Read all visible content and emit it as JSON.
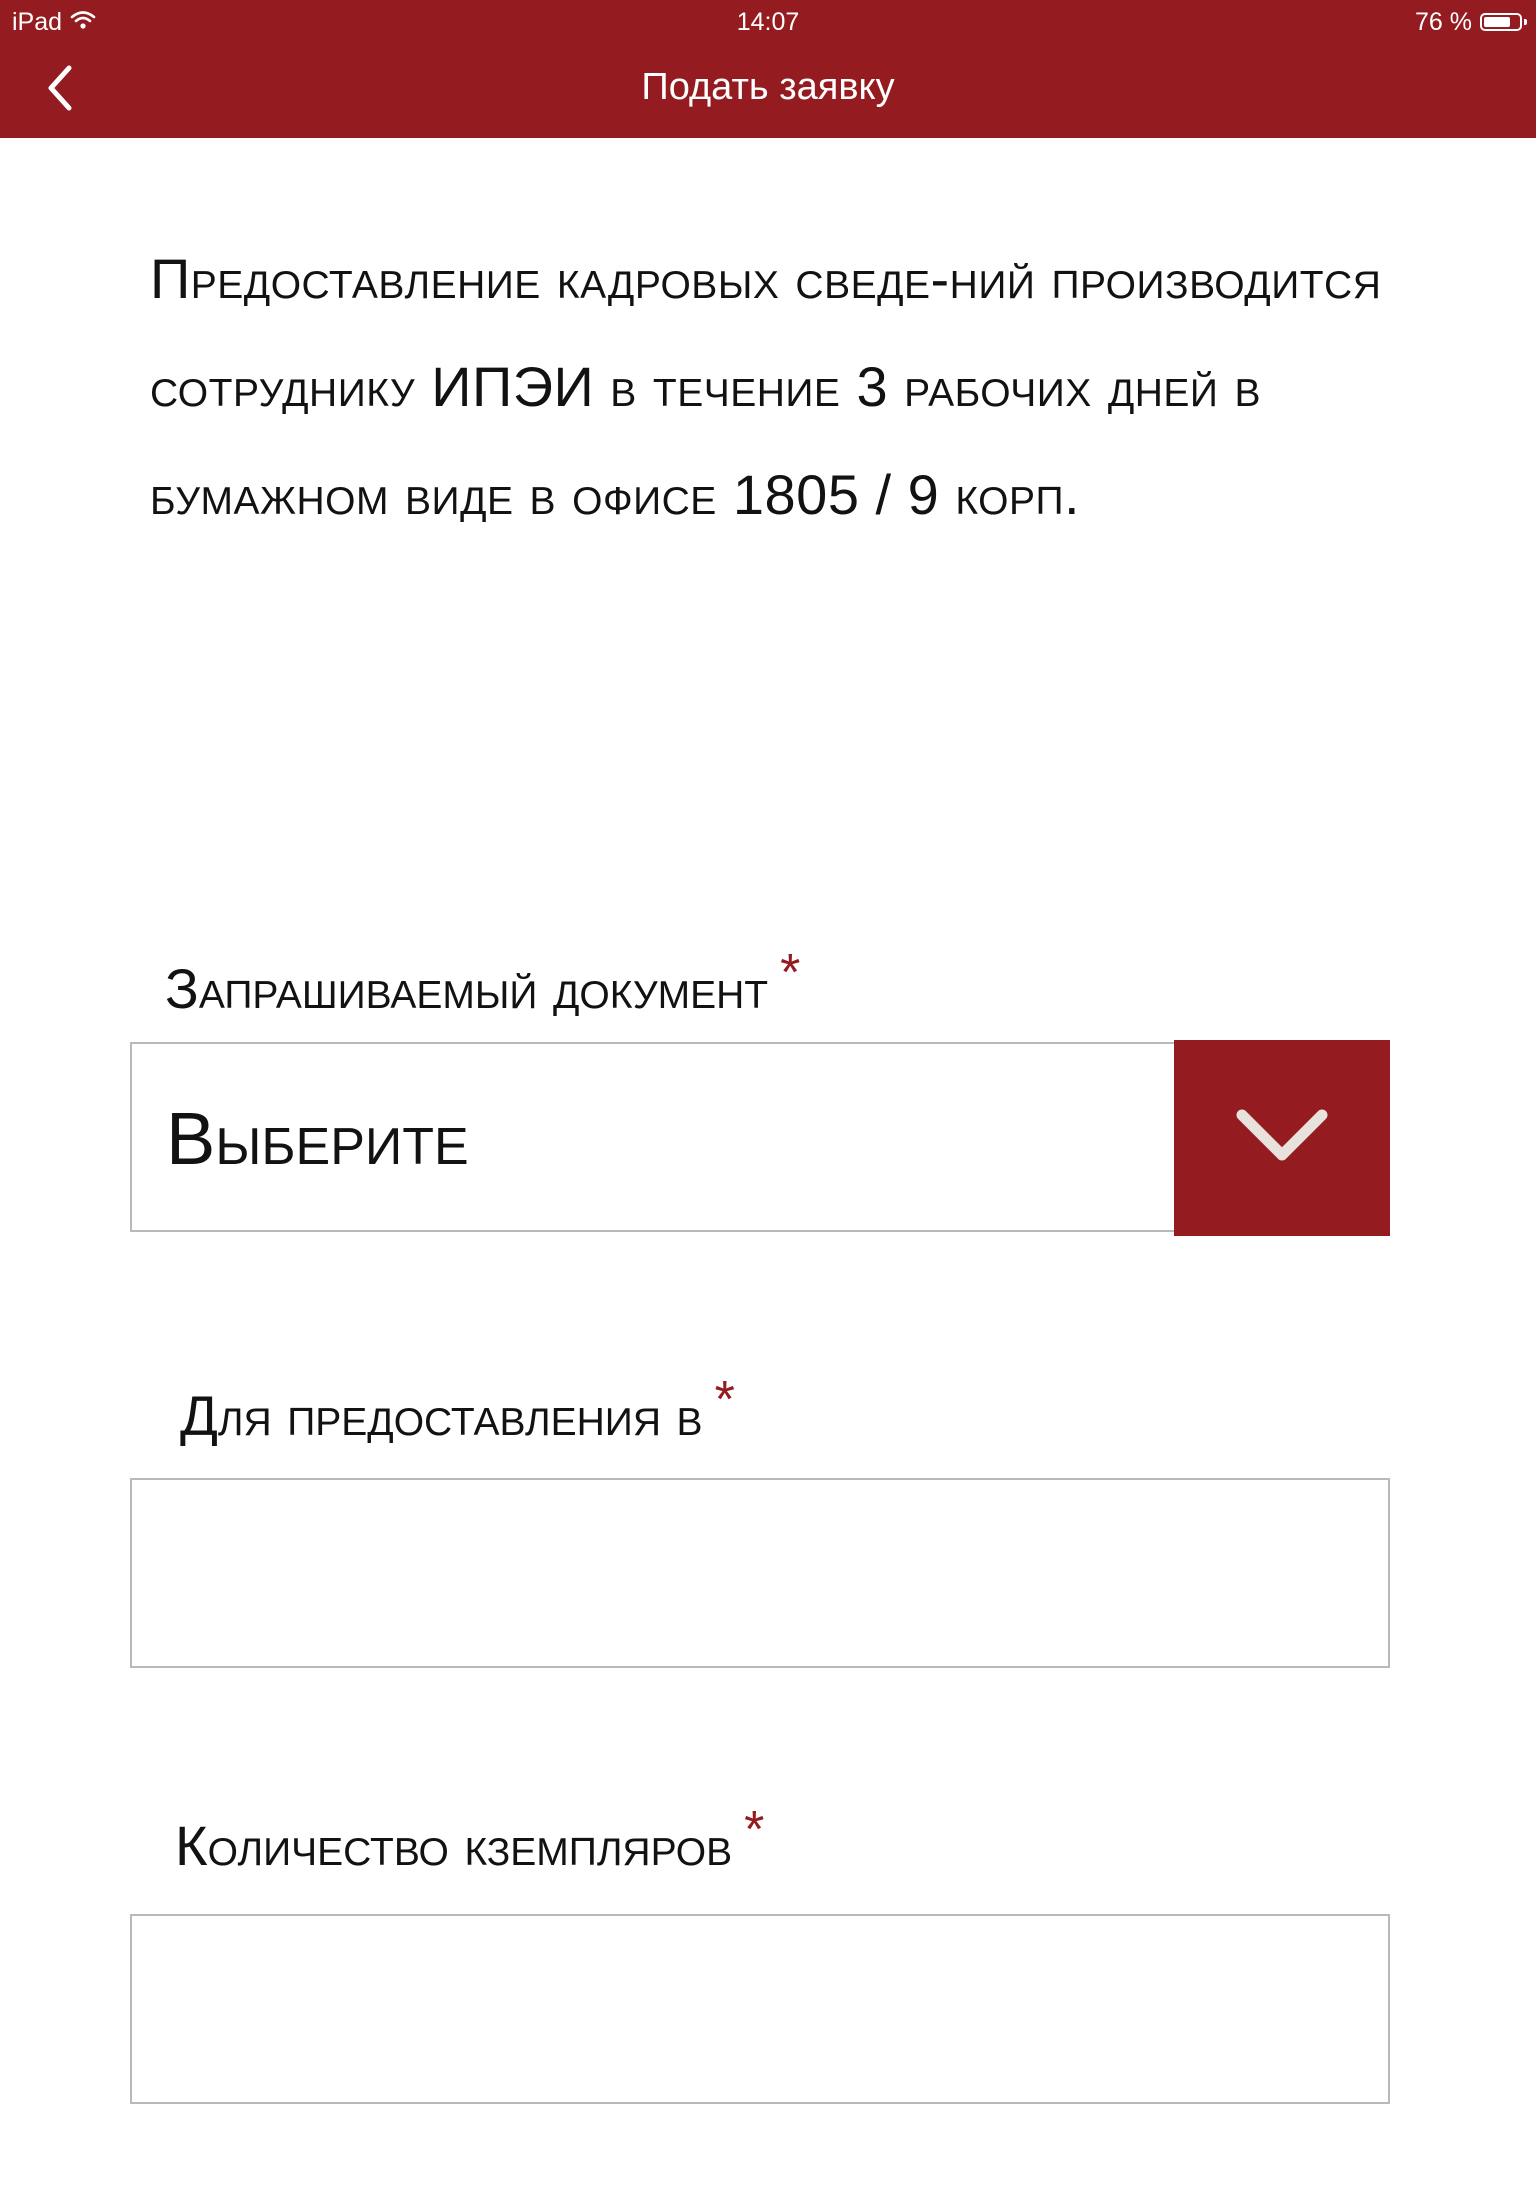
{
  "status_bar": {
    "device": "iPad",
    "time": "14:07",
    "battery": "76 %",
    "battery_level": 0.76
  },
  "nav": {
    "title": "Подать заявку",
    "back_icon": "chevron-left-icon"
  },
  "intro_text": "Предоставление кадровых сведе-ний производится сотруднику ИПЭИ в течение 3 рабочих дней в бумажном виде в офисе 1805 / 9 корп.",
  "form": {
    "document": {
      "label": "Запрашиваемый документ",
      "required_mark": "*",
      "value": "Выберите",
      "dropdown_icon": "chevron-down-icon"
    },
    "destination": {
      "label": "Для предоставления в",
      "required_mark": "*",
      "value": ""
    },
    "copies": {
      "label": "Количество кземпляров",
      "required_mark": "*",
      "value": ""
    }
  },
  "colors": {
    "accent": "#941b1f",
    "border": "#b9b9b9",
    "text": "#121212"
  }
}
